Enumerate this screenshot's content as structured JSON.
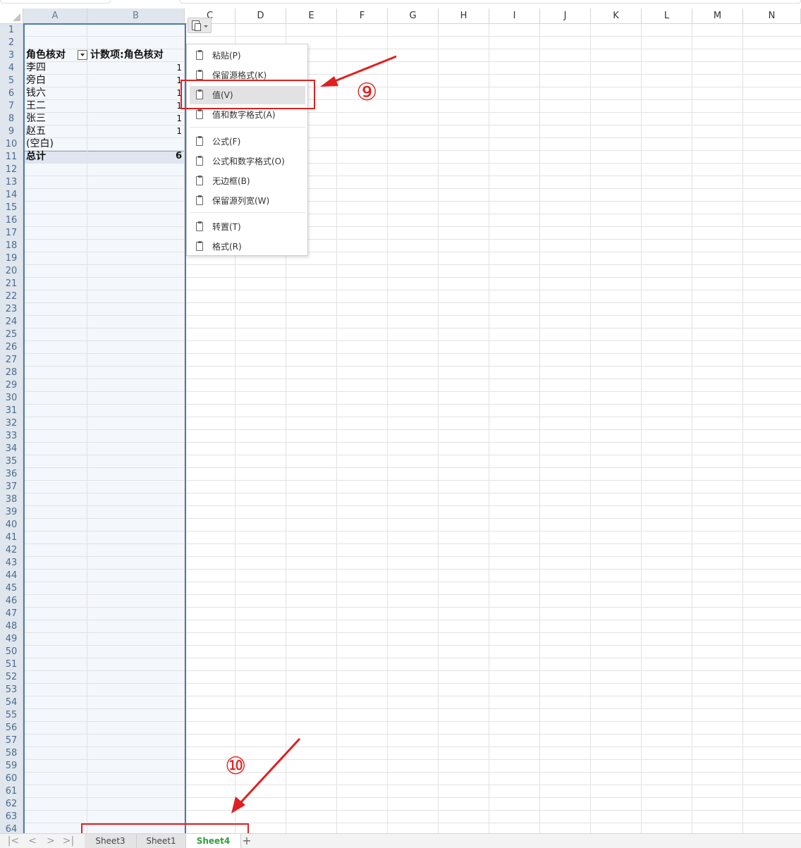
{
  "columns": [
    "A",
    "B",
    "C",
    "D",
    "E",
    "F",
    "G",
    "H",
    "I",
    "J",
    "K",
    "L",
    "M",
    "N"
  ],
  "rows": [
    "1",
    "2",
    "3",
    "4",
    "5",
    "6",
    "7",
    "8",
    "9",
    "10",
    "11",
    "12",
    "13",
    "14",
    "15",
    "16",
    "17",
    "18",
    "19",
    "20",
    "21",
    "22",
    "23",
    "24",
    "25",
    "26",
    "27",
    "28",
    "29",
    "30",
    "31",
    "32",
    "33",
    "34",
    "35",
    "36",
    "37",
    "38",
    "39",
    "40",
    "41",
    "42",
    "43",
    "44",
    "45",
    "46",
    "47",
    "48",
    "49",
    "50",
    "51",
    "52",
    "53",
    "54",
    "55",
    "56",
    "57",
    "58",
    "59",
    "60",
    "61",
    "62",
    "63",
    "64"
  ],
  "pivot": {
    "header_a": "角色核对",
    "header_b": "计数项:角色核对",
    "names": [
      "李四",
      "旁白",
      "钱六",
      "王二",
      "张三",
      "赵五",
      "(空白)"
    ],
    "counts": [
      "1",
      "1",
      "1",
      "1",
      "1",
      "1",
      ""
    ],
    "total_label": "总计",
    "total_value": "6"
  },
  "paste_menu": {
    "items": [
      {
        "label": "粘贴(P)",
        "icon": "paste-icon"
      },
      {
        "label": "保留源格式(K)",
        "icon": "keep-source-format-icon"
      },
      {
        "label": "值(V)",
        "icon": "paste-values-icon"
      },
      {
        "label": "值和数字格式(A)",
        "icon": "values-number-format-icon"
      },
      {
        "label": "公式(F)",
        "icon": "formula-icon"
      },
      {
        "label": "公式和数字格式(O)",
        "icon": "formula-number-format-icon"
      },
      {
        "label": "无边框(B)",
        "icon": "no-borders-icon"
      },
      {
        "label": "保留源列宽(W)",
        "icon": "keep-column-width-icon"
      },
      {
        "label": "转置(T)",
        "icon": "transpose-icon"
      },
      {
        "label": "格式(R)",
        "icon": "format-icon"
      }
    ],
    "highlighted_index": 2
  },
  "annotations": {
    "step9": "⑨",
    "step10": "⑩",
    "color": "#e02020"
  },
  "sheet_tabs": [
    "Sheet3",
    "Sheet1",
    "Sheet4"
  ],
  "active_sheet": "Sheet4",
  "add_sheet_label": "+",
  "nav_buttons": [
    "|<",
    "<",
    ">",
    ">|"
  ],
  "colors": {
    "selection_border": "#4f79b8",
    "active_tab_text": "#2e9e3e",
    "menu_highlight": "#e2e2e2"
  }
}
